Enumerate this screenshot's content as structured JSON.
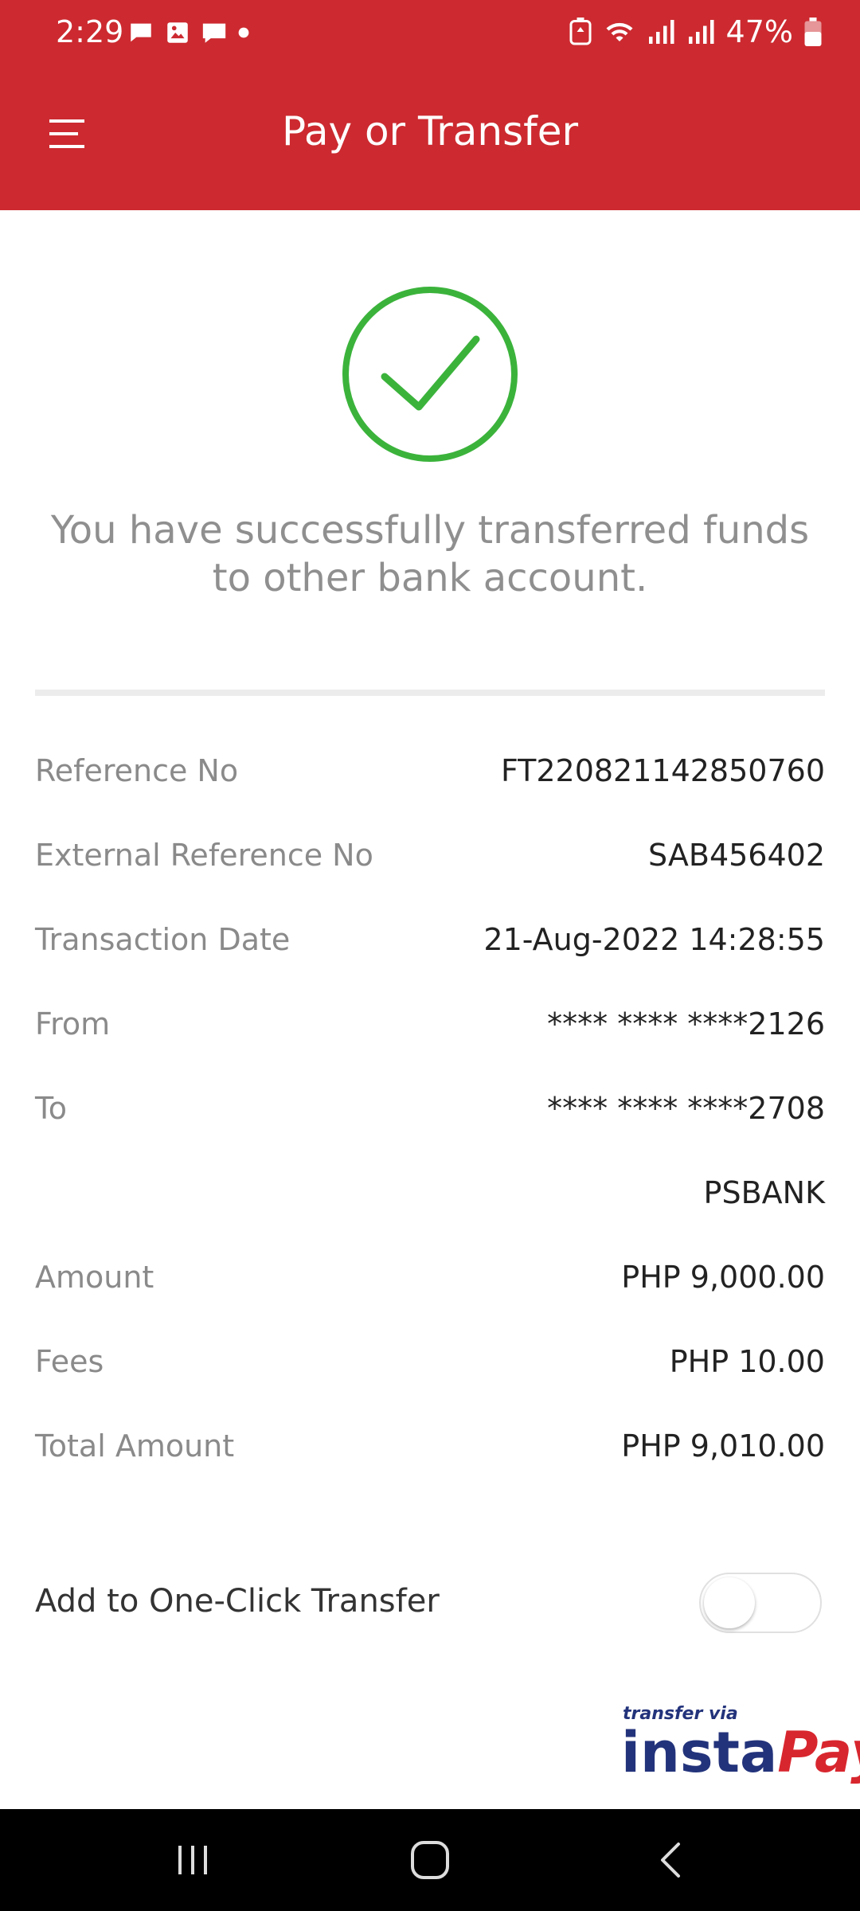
{
  "status_bar": {
    "time": "2:29",
    "battery": "47%",
    "icons": [
      "chat-icon",
      "image-icon",
      "message-icon",
      "dot-icon",
      "battery-saver-icon",
      "wifi-icon",
      "signal-icon",
      "signal-icon",
      "battery-icon"
    ]
  },
  "header": {
    "title": "Pay or Transfer",
    "color": "#cc2a30"
  },
  "success": {
    "message": "You have successfully transferred funds to other bank account.",
    "icon": "check-circle-icon",
    "icon_color": "#3bb33b"
  },
  "details": {
    "rows": [
      {
        "label": "Reference No",
        "value": "FT220821142850760"
      },
      {
        "label": "External Reference No",
        "value": "SAB456402"
      },
      {
        "label": "Transaction Date",
        "value": "21-Aug-2022 14:28:55"
      },
      {
        "label": "From",
        "value": "**** **** ****2126"
      },
      {
        "label": "To",
        "value": "**** **** ****2708"
      },
      {
        "label": "",
        "value": "PSBANK"
      },
      {
        "label": "Amount",
        "value": "PHP 9,000.00"
      },
      {
        "label": "Fees",
        "value": "PHP 10.00"
      },
      {
        "label": "Total Amount",
        "value": "PHP 9,010.00"
      }
    ]
  },
  "one_click": {
    "label": "Add to One-Click Transfer",
    "enabled": false
  },
  "logo": {
    "caption": "transfer via",
    "insta": "insta",
    "pay": "Pay"
  },
  "nav": {
    "icons": [
      "recent-apps-icon",
      "home-icon",
      "back-icon"
    ]
  }
}
